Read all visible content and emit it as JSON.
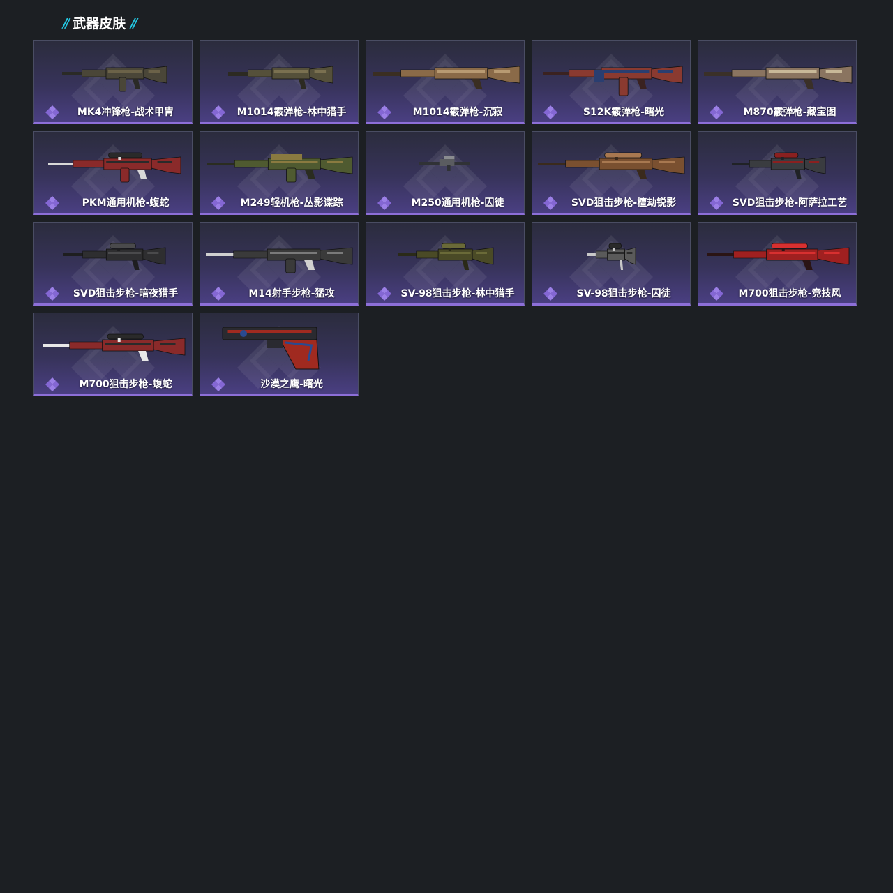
{
  "section": {
    "title": "武器皮肤"
  },
  "colors": {
    "background": "#1c1f23",
    "accent_slashes": "#24c6e0",
    "rarity_purple": "#8d6fd8",
    "card_border": "#4a4d63"
  },
  "skins": [
    {
      "name": "MK4冲锋枪-战术甲胄",
      "weapon_icon": "rifle-icon"
    },
    {
      "name": "M1014霰弹枪-林中猎手",
      "weapon_icon": "shotgun-icon"
    },
    {
      "name": "M1014霰弹枪-沉寂",
      "weapon_icon": "shotgun-icon"
    },
    {
      "name": "S12K霰弹枪-曙光",
      "weapon_icon": "shotgun-icon"
    },
    {
      "name": "M870霰弹枪-藏宝图",
      "weapon_icon": "shotgun-icon"
    },
    {
      "name": "PKM通用机枪-蝮蛇",
      "weapon_icon": "machine-gun-icon"
    },
    {
      "name": "M249轻机枪-丛影谍踪",
      "weapon_icon": "machine-gun-icon"
    },
    {
      "name": "M250通用机枪-囚徒",
      "weapon_icon": "machine-gun-icon"
    },
    {
      "name": "SVD狙击步枪-檀劫锐影",
      "weapon_icon": "sniper-rifle-icon"
    },
    {
      "name": "SVD狙击步枪-阿萨拉工艺",
      "weapon_icon": "sniper-rifle-icon"
    },
    {
      "name": "SVD狙击步枪-暗夜猎手",
      "weapon_icon": "sniper-rifle-icon"
    },
    {
      "name": "M14射手步枪-猛攻",
      "weapon_icon": "rifle-icon"
    },
    {
      "name": "SV-98狙击步枪-林中猎手",
      "weapon_icon": "sniper-rifle-icon"
    },
    {
      "name": "SV-98狙击步枪-囚徒",
      "weapon_icon": "sniper-rifle-icon"
    },
    {
      "name": "M700狙击步枪-竞技风",
      "weapon_icon": "sniper-rifle-icon"
    },
    {
      "name": "M700狙击步枪-蝮蛇",
      "weapon_icon": "sniper-rifle-icon"
    },
    {
      "name": "沙漠之鹰-曙光",
      "weapon_icon": "pistol-icon"
    }
  ]
}
